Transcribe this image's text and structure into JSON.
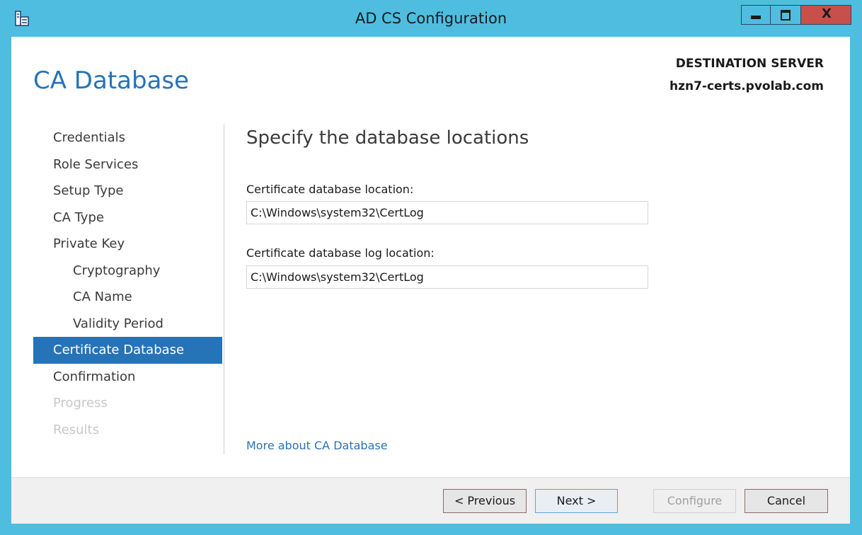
{
  "window": {
    "title": "AD CS Configuration",
    "close_glyph": "X",
    "icons": [
      "app-icon",
      "minimize-icon",
      "maximize-icon",
      "close-icon"
    ]
  },
  "header": {
    "page_title": "CA Database",
    "destination_label": "DESTINATION SERVER",
    "destination_server": "hzn7-certs.pvolab.com"
  },
  "nav": {
    "items": [
      {
        "label": "Credentials",
        "state": "normal"
      },
      {
        "label": "Role Services",
        "state": "normal"
      },
      {
        "label": "Setup Type",
        "state": "normal"
      },
      {
        "label": "CA Type",
        "state": "normal"
      },
      {
        "label": "Private Key",
        "state": "normal"
      },
      {
        "label": "Cryptography",
        "state": "sub"
      },
      {
        "label": "CA Name",
        "state": "sub"
      },
      {
        "label": "Validity Period",
        "state": "sub"
      },
      {
        "label": "Certificate Database",
        "state": "active"
      },
      {
        "label": "Confirmation",
        "state": "normal"
      },
      {
        "label": "Progress",
        "state": "disabled"
      },
      {
        "label": "Results",
        "state": "disabled"
      }
    ]
  },
  "main": {
    "heading": "Specify the database locations",
    "db_location_label": "Certificate database location:",
    "db_location_value": "C:\\Windows\\system32\\CertLog",
    "log_location_label": "Certificate database log location:",
    "log_location_value": "C:\\Windows\\system32\\CertLog",
    "more_link": "More about CA Database"
  },
  "footer": {
    "previous_label": "< Previous",
    "next_label": "Next >",
    "configure_label": "Configure",
    "cancel_label": "Cancel"
  },
  "colors": {
    "window_chrome": "#4ebde0",
    "accent": "#2673b8",
    "close_button": "#c7504a"
  }
}
